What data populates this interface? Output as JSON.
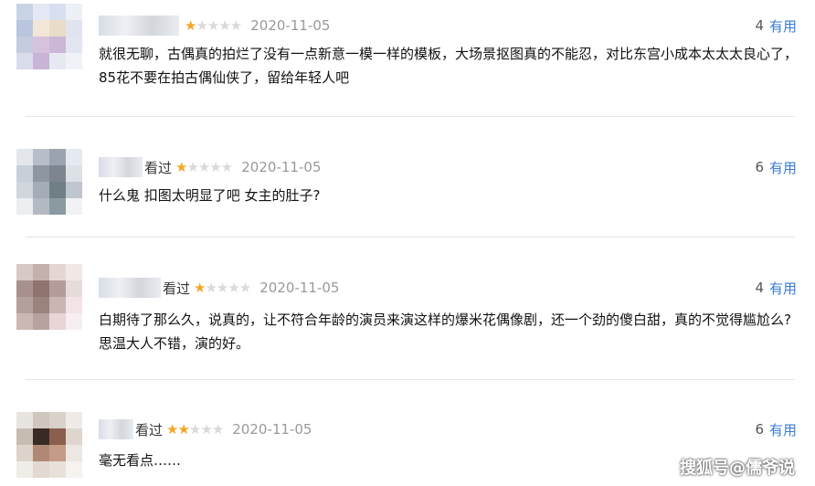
{
  "reviews": [
    {
      "seen_label": "",
      "stars": "★☆☆☆☆",
      "date": "2020-11-05",
      "count": "4",
      "useful_label": "有用",
      "text": "就很无聊，古偶真的拍烂了没有一点新意一模一样的模板，大场景抠图真的不能忍，对比东宫小成本太太太良心了，85花不要在拍古偶仙侠了，留给年轻人吧"
    },
    {
      "seen_label": "看过",
      "stars": "★☆☆☆☆",
      "date": "2020-11-05",
      "count": "6",
      "useful_label": "有用",
      "text": "什么鬼 扣图太明显了吧 女主的肚子?"
    },
    {
      "seen_label": "看过",
      "stars": "★☆☆☆☆",
      "date": "2020-11-05",
      "count": "4",
      "useful_label": "有用",
      "text": "白期待了那么久，说真的，让不符合年龄的演员来演这样的爆米花偶像剧，还一个劲的傻白甜，真的不觉得尴尬么? 思温大人不错，演的好。"
    },
    {
      "seen_label": "看过",
      "stars": "★★☆☆☆",
      "date": "2020-11-05",
      "count": "6",
      "useful_label": "有用",
      "text": "毫无看点……"
    }
  ],
  "watermark": "搜狐号@儒爷说"
}
